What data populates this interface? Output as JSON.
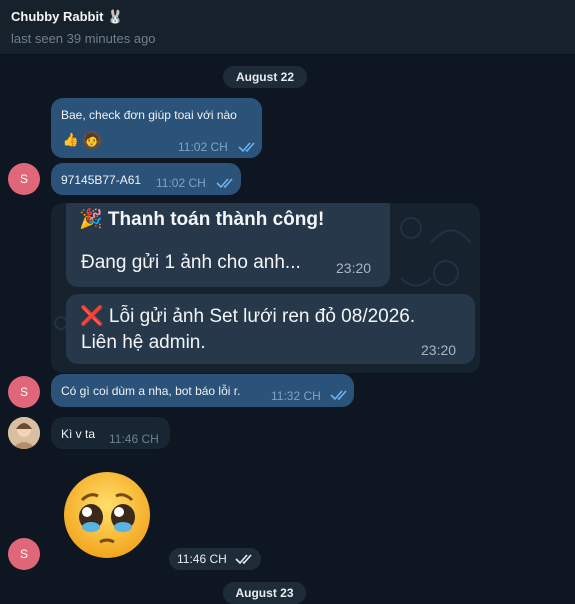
{
  "header": {
    "title": "Chubby Rabbit 🐰",
    "status": "last seen 39 minutes ago"
  },
  "dates": {
    "first": "August 22",
    "second": "August 23"
  },
  "messages": [
    {
      "text": "Bae, check đơn giúp toai với nào",
      "time": "11:02 CH",
      "reactions": [
        "👍",
        "🧑"
      ]
    },
    {
      "text": "97145B77-A61",
      "time": "11:02 CH",
      "avatar": "S"
    },
    {
      "text": "Có gì coi dùm a nha, bot báo lỗi r.",
      "time": "11:32 CH",
      "avatar": "S"
    },
    {
      "text": "Kì v ta",
      "time": "11:46 CH"
    },
    {
      "time": "11:46 CH",
      "avatar": "S"
    }
  ],
  "image_cards": {
    "success_line1": "🎉 Thanh toán thành công!",
    "success_line2": "Đang gửi 1 ảnh cho anh...",
    "success_time": "23:20",
    "error_line1": "❌ Lỗi gửi ảnh Set lưới ren đỏ 08/2026.",
    "error_line2": "Liên hệ admin.",
    "error_time": "23:20"
  },
  "colors": {
    "background": "#0e1621",
    "header": "#17212b",
    "outgoing_bubble": "#2b5278",
    "incoming_bubble": "#182533",
    "avatar": "#e0667a",
    "tick": "#6ab3f3"
  }
}
